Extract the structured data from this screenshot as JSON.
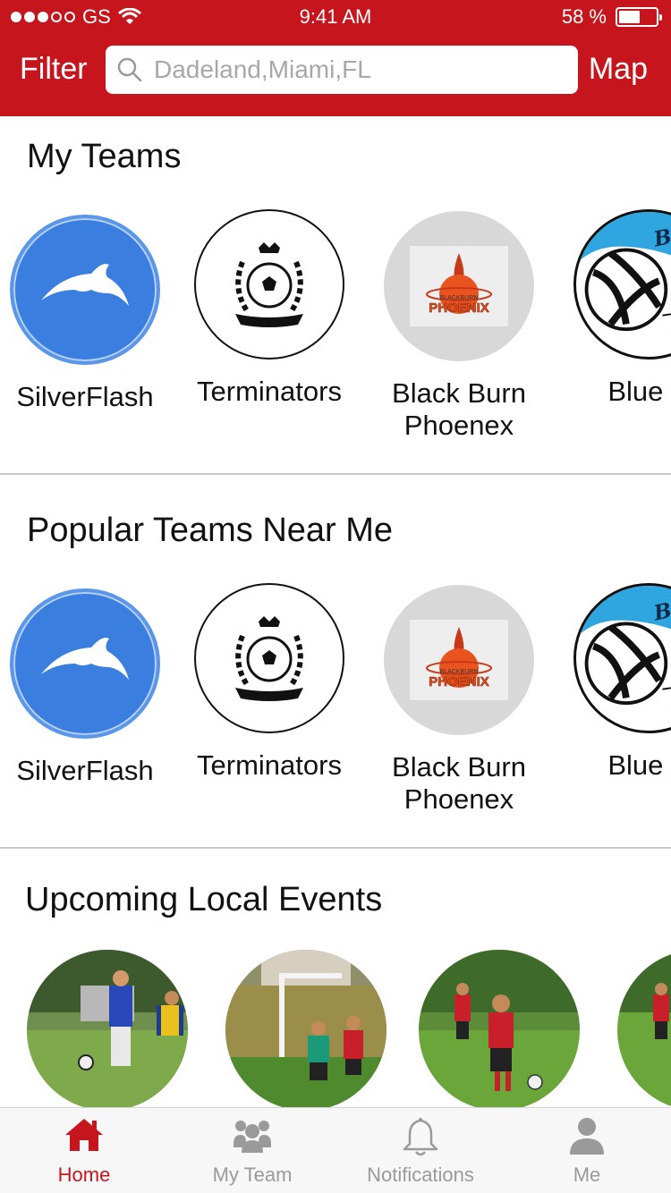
{
  "status_bar": {
    "carrier": "GS",
    "time": "9:41 AM",
    "battery": "58 %",
    "battery_level": 0.58
  },
  "header": {
    "filter_label": "Filter",
    "map_label": "Map",
    "search_placeholder": "Dadeland,Miami,FL",
    "accent_color": "#c6151d"
  },
  "sections": {
    "my_teams": {
      "title": "My Teams",
      "teams": [
        {
          "name": "SilverFlash",
          "icon": "dolphin-logo"
        },
        {
          "name": "Terminators",
          "icon": "soccer-crest-logo"
        },
        {
          "name": "Black Burn Phoenex",
          "icon": "phoenix-logo",
          "logo_text_top": "BLACKBURN",
          "logo_text": "PHOENIX"
        },
        {
          "name": "Blue S",
          "icon": "volleyball-logo",
          "logo_text": "Blue S"
        }
      ]
    },
    "popular": {
      "title": "Popular Teams Near Me",
      "teams": [
        {
          "name": "SilverFlash",
          "icon": "dolphin-logo"
        },
        {
          "name": "Terminators",
          "icon": "soccer-crest-logo"
        },
        {
          "name": "Black Burn Phoenex",
          "icon": "phoenix-logo",
          "logo_text_top": "BLACKBURN",
          "logo_text": "PHOENIX"
        },
        {
          "name": "Blue S",
          "icon": "volleyball-logo",
          "logo_text": "Blue S"
        }
      ]
    },
    "events": {
      "title": "Upcoming Local Events",
      "items": [
        {
          "image": "soccer-match-photo"
        },
        {
          "image": "youth-soccer-photo"
        },
        {
          "image": "youth-soccer-field-photo"
        },
        {
          "image": "youth-soccer-partial-photo"
        }
      ]
    }
  },
  "tabbar": {
    "tabs": [
      {
        "label": "Home",
        "icon": "home-icon",
        "active": true
      },
      {
        "label": "My Team",
        "icon": "group-icon",
        "active": false
      },
      {
        "label": "Notifications",
        "icon": "bell-icon",
        "active": false
      },
      {
        "label": "Me",
        "icon": "person-icon",
        "active": false
      }
    ]
  }
}
